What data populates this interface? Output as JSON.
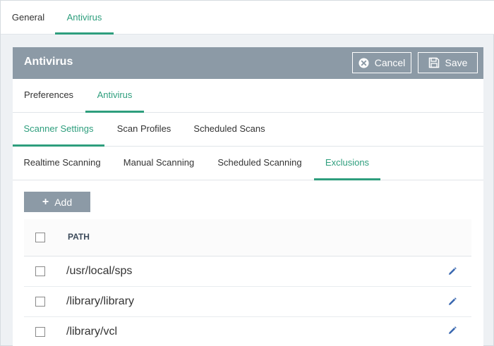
{
  "top_tabs": [
    {
      "label": "General",
      "active": false
    },
    {
      "label": "Antivirus",
      "active": true
    }
  ],
  "panel": {
    "title": "Antivirus",
    "cancel_label": "Cancel",
    "save_label": "Save"
  },
  "section_tabs": [
    {
      "label": "Preferences",
      "active": false
    },
    {
      "label": "Antivirus",
      "active": true
    }
  ],
  "scanner_tabs": [
    {
      "label": "Scanner Settings",
      "active": true
    },
    {
      "label": "Scan Profiles",
      "active": false
    },
    {
      "label": "Scheduled Scans",
      "active": false
    }
  ],
  "scan_tabs": [
    {
      "label": "Realtime Scanning",
      "active": false
    },
    {
      "label": "Manual Scanning",
      "active": false
    },
    {
      "label": "Scheduled Scanning",
      "active": false
    },
    {
      "label": "Exclusions",
      "active": true
    }
  ],
  "add_label": "Add",
  "table": {
    "header": "PATH",
    "rows": [
      {
        "path": "/usr/local/sps"
      },
      {
        "path": "/library/library"
      },
      {
        "path": "/library/vcl"
      }
    ]
  },
  "colors": {
    "accent": "#2e9e7d",
    "header_bg": "#8c9aa6",
    "page_bg": "#eef1f4"
  },
  "icons": {
    "cancel": "circle-x-icon",
    "save": "floppy-disk-icon",
    "add": "plus-icon",
    "edit": "pencil-icon"
  }
}
